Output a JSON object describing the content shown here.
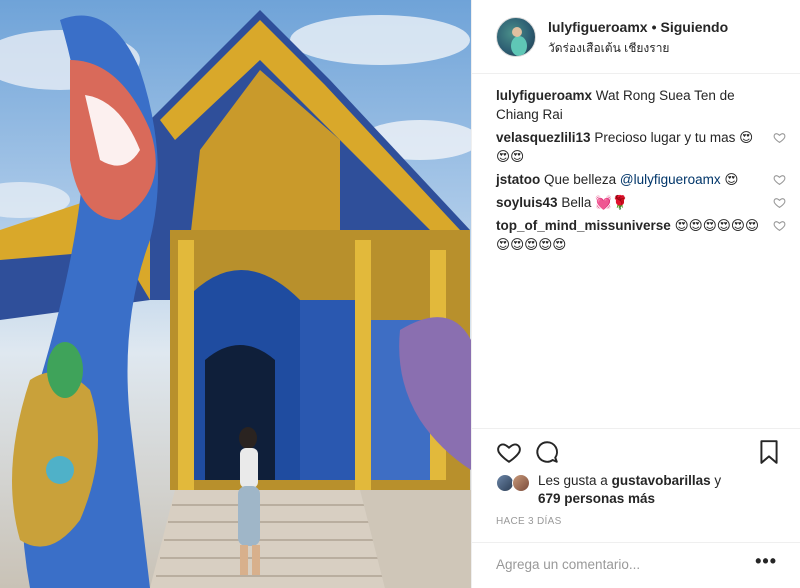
{
  "post": {
    "image_alt": "Wat Rong Suea Ten temple photo",
    "header": {
      "username": "lulyfigueroamx",
      "separator": "•",
      "follow_status": "Siguiendo",
      "location": "วัดร่องเสือเต้น เชียงราย"
    },
    "caption": {
      "user": "lulyfigueroamx",
      "text": "Wat Rong Suea Ten de Chiang Rai"
    },
    "comments": [
      {
        "user": "velasquezlili13",
        "text": "Precioso lugar y tu mas",
        "emoji": "😍😍😍"
      },
      {
        "user": "jstatoo",
        "text": "Que belleza",
        "mention": "@lulyfigueroamx",
        "emoji": "😍"
      },
      {
        "user": "soyluis43",
        "text": "Bella",
        "emoji": "💓🌹"
      },
      {
        "user": "top_of_mind_missuniverse",
        "text": "",
        "emoji": "😍😍😍😍😍😍😍😍😍😍😍"
      }
    ],
    "likes": {
      "prefix": "Les gusta a",
      "user": "gustavobarillas",
      "conjunction": "y",
      "others": "679 personas más"
    },
    "timestamp": "HACE 3 DÍAS",
    "add_comment_placeholder": "Agrega un comentario...",
    "more_label": "•••",
    "colors": {
      "text": "#262626",
      "muted": "#999999",
      "link": "#003569",
      "border": "#efefef"
    },
    "icons": [
      "heart-icon",
      "comment-icon",
      "bookmark-icon",
      "small-heart-icon",
      "more-options-icon"
    ]
  }
}
